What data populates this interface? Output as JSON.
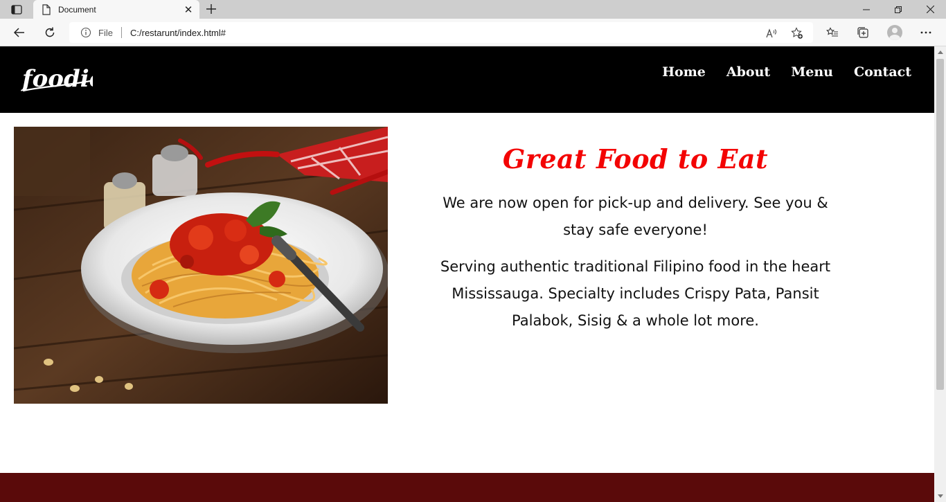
{
  "browser": {
    "tab_title": "Document",
    "url_scheme_label": "File",
    "url": "C:/restarunt/index.html#"
  },
  "site": {
    "logo_text": "foodie",
    "nav": [
      {
        "label": "Home"
      },
      {
        "label": "About"
      },
      {
        "label": "Menu"
      },
      {
        "label": "Contact"
      }
    ],
    "hero": {
      "title": "Great Food to Eat",
      "paragraph1": "We are now open for pick-up and delivery. See you & stay safe everyone!",
      "paragraph2": "Serving authentic traditional Filipino food in the heart Mississauga. Specialty includes Crispy Pata, Pansit Palabok, Sisig & a whole lot more.",
      "image_icon": "spaghetti-plate-photo"
    }
  },
  "colors": {
    "header_bg": "#000000",
    "title_red": "#f30404",
    "footer_band": "#5a0a0a"
  }
}
